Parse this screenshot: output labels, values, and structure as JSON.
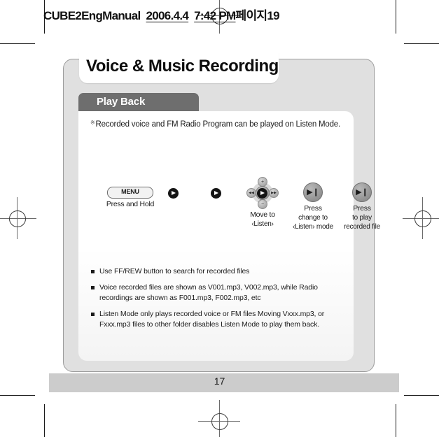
{
  "print_header": {
    "document_name": "CUBE2EngManual",
    "date": "2006.4.4",
    "time": "7:42 PM",
    "page_label": "페이지19",
    "full_text": "CUBE2EngManual  2006.4.4  7:42 PM페이지19"
  },
  "manual": {
    "title": "Voice & Music Recording",
    "section_tab": "Play Back",
    "intro": {
      "reference_mark": "※",
      "text": "Recorded voice and FM Radio Program can be played on Listen Mode."
    },
    "steps": [
      {
        "control": "MENU",
        "control_type": "menu-pill",
        "caption_primary": "Press and Hold",
        "caption_secondary": ""
      },
      {
        "control": "dpad",
        "control_type": "dpad",
        "caption_primary": "Move to",
        "caption_secondary": "‹Listen›"
      },
      {
        "control": "▶❙",
        "control_type": "play-button",
        "caption_primary": "Press",
        "caption_secondary": "change to",
        "caption_tertiary": "‹Listen› mode"
      },
      {
        "control": "▶❙",
        "control_type": "play-button",
        "caption_primary": "Press",
        "caption_secondary": "to play",
        "caption_tertiary": "recorded file"
      }
    ],
    "dpad_buttons": {
      "up": "+",
      "down": "−",
      "left": "◀◀",
      "right": "▶▶",
      "center": "▶❙"
    },
    "arrow_icons": [
      "arrow-right",
      "arrow-right",
      "arrow-right"
    ],
    "notes": [
      "Use FF/REW button to search for recorded files",
      "Voice recorded files are shown as V001.mp3, V002.mp3,  while Radio recordings are shown as F001.mp3, F002.mp3, etc",
      "Listen Mode only plays recorded voice or FM files Moving Vxxx.mp3, or Fxxx.mp3 files to other folder disables Listen Mode to play them back."
    ],
    "page_number": "17"
  },
  "colors": {
    "page_background": "#e0e0e0",
    "tab_background": "#6e6e6e",
    "tab_text": "#ffffff",
    "content_panel": "#ffffff",
    "footer_bar": "#cccccc",
    "arrow_chip": "#141414",
    "button_gray": "#9a9a9a",
    "text": "#1b1b1b"
  }
}
